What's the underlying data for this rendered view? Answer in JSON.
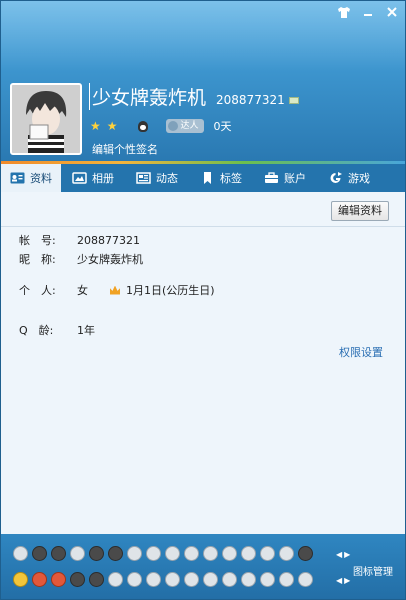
{
  "window": {
    "controls": [
      "skin-icon",
      "minimize-icon",
      "close-icon"
    ]
  },
  "profile": {
    "nickname": "少女牌轰炸机",
    "qq_number": "208877321",
    "badge_label": "达人",
    "days": "0天",
    "signature_placeholder": "编辑个性签名"
  },
  "tabs": [
    {
      "label": "资料",
      "icon": "profile-card-icon"
    },
    {
      "label": "相册",
      "icon": "photo-album-icon"
    },
    {
      "label": "动态",
      "icon": "feed-icon"
    },
    {
      "label": "标签",
      "icon": "bookmark-icon"
    },
    {
      "label": "账户",
      "icon": "wallet-icon"
    },
    {
      "label": "游戏",
      "icon": "game-icon"
    }
  ],
  "content": {
    "edit_button": "编辑资料",
    "fields": {
      "account_label": "帐　号:",
      "account_value": "208877321",
      "nickname_label": "昵　称:",
      "nickname_value": "少女牌轰炸机",
      "personal_label": "个　人:",
      "gender": "女",
      "birthday": "1月1日(公历生日)",
      "qage_label": "Q　龄:",
      "qage_value": "1年"
    },
    "permission_link": "权限设置"
  },
  "bottom": {
    "icon_manage": "图标管理"
  },
  "colors": {
    "header": "#3c94cd",
    "tabbar": "#2474ad",
    "link": "#2b6fb3"
  }
}
